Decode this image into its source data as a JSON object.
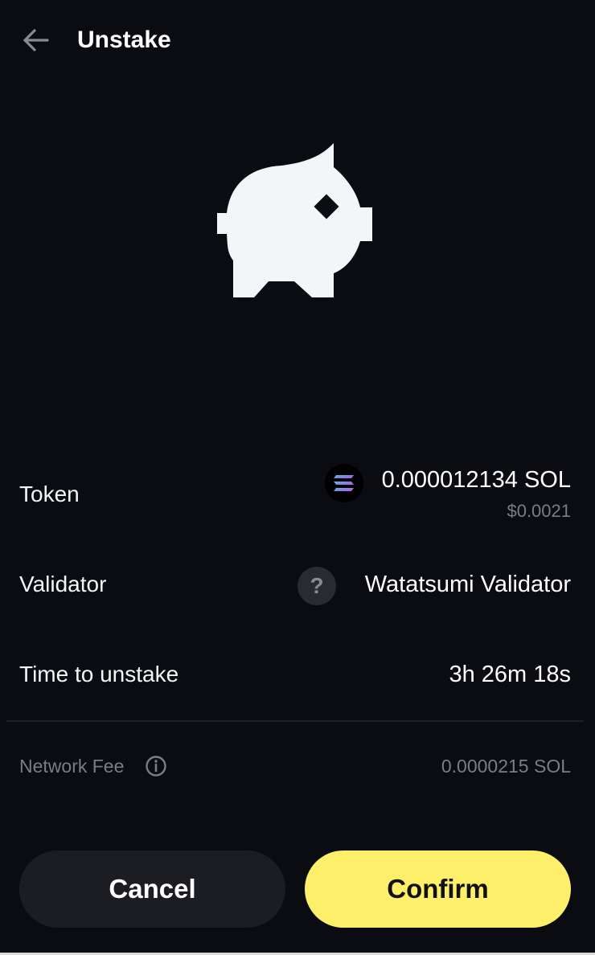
{
  "header": {
    "title": "Unstake",
    "back_icon": "arrow-left-icon"
  },
  "hero": {
    "icon": "piggy-bank-icon"
  },
  "token": {
    "label": "Token",
    "icon": "solana-logo-icon",
    "amount": "0.000012134 SOL",
    "usd_value": "$0.0021"
  },
  "validator": {
    "label": "Validator",
    "icon_glyph": "?",
    "icon": "unknown-validator-icon",
    "name": "Watatsumi Validator"
  },
  "unstake_time": {
    "label": "Time to unstake",
    "value": "3h 26m 18s"
  },
  "network_fee": {
    "label": "Network Fee",
    "info_icon": "info-icon",
    "value": "0.0000215 SOL"
  },
  "actions": {
    "cancel_label": "Cancel",
    "confirm_label": "Confirm"
  },
  "colors": {
    "background": "#0b0c11",
    "confirm_accent": "#fdef6a",
    "muted_text": "#7b7d85"
  }
}
